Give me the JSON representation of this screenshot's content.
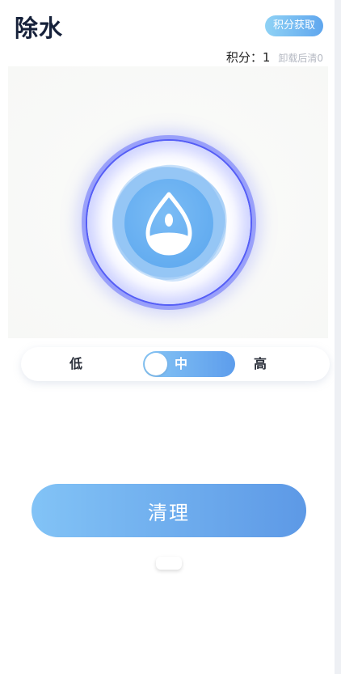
{
  "header": {
    "title": "除水",
    "points_button": "积分获取",
    "points_label": "积分：1",
    "points_note": "卸载后清0"
  },
  "levels": {
    "low": "低",
    "mid": "中",
    "high": "高",
    "selected": "中"
  },
  "actions": {
    "clean_label": "清理"
  },
  "colors": {
    "accent": "#5fa6ee",
    "ring": "#5a5af5"
  },
  "icons": {
    "center": "water-drop-icon"
  }
}
